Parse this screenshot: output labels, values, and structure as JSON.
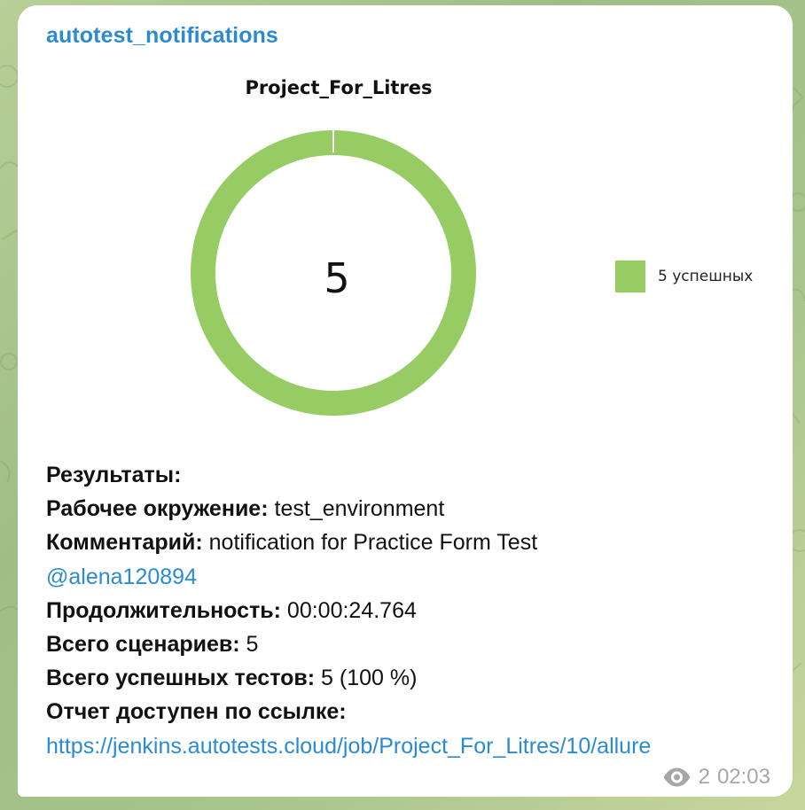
{
  "sender": "autotest_notifications",
  "chart": {
    "title": "Project_For_Litres",
    "center_value": "5",
    "legend_label": "5 успешных",
    "colors": {
      "passed": "#97cc64"
    }
  },
  "chart_data": {
    "type": "pie",
    "categories": [
      "5 успешных"
    ],
    "values": [
      5
    ],
    "title": "Project_For_Litres",
    "center_label": "5",
    "legend_placement": "right"
  },
  "message": {
    "results_heading": "Результаты:",
    "env_label": "Рабочее окружение:",
    "env_value": "test_environment",
    "comment_label": "Комментарий:",
    "comment_value": "notification for Practice Form Test",
    "mention": "@alena120894",
    "duration_label": "Продолжительность:",
    "duration_value": "00:00:24.764",
    "total_label": "Всего сценариев:",
    "total_value": "5",
    "passed_label": "Всего успешных тестов:",
    "passed_value": "5 (100 %)",
    "report_label": "Отчет доступен по ссылке:",
    "report_link": "https://jenkins.autotests.cloud/job/Project_For_Litres/10/allure"
  },
  "meta": {
    "views": "2",
    "time": "02:03",
    "views_icon": "eye-icon"
  },
  "colors": {
    "link": "#2a8bd1",
    "chart_green": "#97cc64",
    "meta_gray": "#a7a7a7"
  }
}
